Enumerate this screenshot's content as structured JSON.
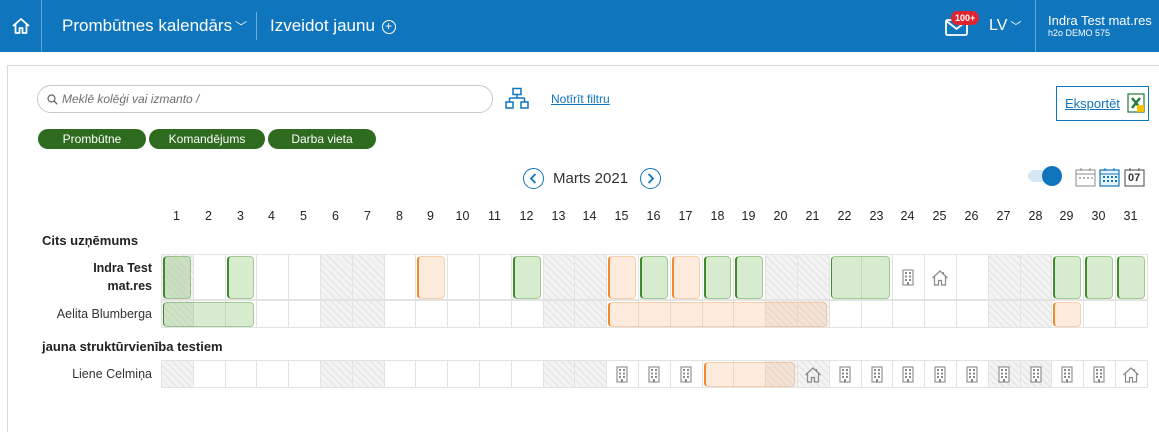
{
  "topbar": {
    "home_icon": "home-icon",
    "title": "Prombūtnes kalendārs",
    "create_label": "Izveidot jaunu",
    "mail_icon": "mail-icon",
    "notification_count": "100+",
    "language": "LV",
    "user_name": "Indra Test mat.res",
    "user_org": "h2o DEMO 575"
  },
  "toolbar": {
    "search_placeholder": "Meklē kolēģi vai izmanto /",
    "search_value": "",
    "clear_filter": "Notīrīt filtru",
    "export_label": "Eksportēt"
  },
  "chips": [
    "Prombūtne",
    "Komandējums",
    "Darba vieta"
  ],
  "calendar": {
    "month_label": "Marts 2021",
    "today_label": "07",
    "days": [
      "1",
      "2",
      "3",
      "4",
      "5",
      "6",
      "7",
      "8",
      "9",
      "10",
      "11",
      "12",
      "13",
      "14",
      "15",
      "16",
      "17",
      "18",
      "19",
      "20",
      "21",
      "22",
      "23",
      "24",
      "25",
      "26",
      "27",
      "28",
      "29",
      "30",
      "31"
    ],
    "weekend_days": [
      6,
      7,
      13,
      14,
      20,
      21,
      27,
      28
    ],
    "sections": [
      {
        "name": "Cits uzņēmums",
        "people": [
          {
            "name_lines": [
              "Indra Test",
              "mat.res"
            ],
            "bold": true,
            "hatched_extra_days": [
              1
            ],
            "marks": [
              {
                "start": 1,
                "end": 1,
                "color": "g",
                "hatch": true
              },
              {
                "start": 3,
                "end": 3,
                "color": "g"
              },
              {
                "start": 9,
                "end": 9,
                "color": "o"
              },
              {
                "start": 12,
                "end": 12,
                "color": "g"
              },
              {
                "start": 15,
                "end": 15,
                "color": "o"
              },
              {
                "start": 16,
                "end": 16,
                "color": "g"
              },
              {
                "start": 17,
                "end": 17,
                "color": "o"
              },
              {
                "start": 18,
                "end": 18,
                "color": "g"
              },
              {
                "start": 19,
                "end": 19,
                "color": "g"
              },
              {
                "start": 22,
                "end": 23,
                "color": "g",
                "thin": true
              },
              {
                "start": 29,
                "end": 29,
                "color": "g"
              },
              {
                "start": 30,
                "end": 30,
                "color": "g"
              },
              {
                "start": 31,
                "end": 31,
                "color": "g"
              }
            ],
            "icons": [
              {
                "day": 24,
                "type": "office"
              },
              {
                "day": 25,
                "type": "home"
              }
            ]
          },
          {
            "name_lines": [
              "Aelita Blumberga"
            ],
            "bold": false,
            "hatched_extra_days": [
              1
            ],
            "marks": [
              {
                "start": 1,
                "end": 3,
                "color": "g",
                "thin": true
              },
              {
                "start": 15,
                "end": 21,
                "color": "o"
              },
              {
                "start": 29,
                "end": 29,
                "color": "o"
              }
            ],
            "icons": []
          }
        ]
      },
      {
        "name": "jauna struktūrvienība testiem",
        "people": [
          {
            "name_lines": [
              "Liene Celmiņa"
            ],
            "bold": false,
            "hatched_extra_days": [
              1
            ],
            "marks": [
              {
                "start": 18,
                "end": 20,
                "color": "o"
              }
            ],
            "icons": [
              {
                "day": 15,
                "type": "office"
              },
              {
                "day": 16,
                "type": "office"
              },
              {
                "day": 17,
                "type": "office"
              },
              {
                "day": 21,
                "type": "home"
              },
              {
                "day": 22,
                "type": "office"
              },
              {
                "day": 23,
                "type": "office"
              },
              {
                "day": 24,
                "type": "office"
              },
              {
                "day": 25,
                "type": "office"
              },
              {
                "day": 26,
                "type": "office"
              },
              {
                "day": 27,
                "type": "office"
              },
              {
                "day": 28,
                "type": "office"
              },
              {
                "day": 29,
                "type": "office"
              },
              {
                "day": 30,
                "type": "office"
              },
              {
                "day": 31,
                "type": "home"
              }
            ]
          }
        ]
      }
    ]
  },
  "colors": {
    "brand_blue": "#0f75bd",
    "chip_green": "#2f6b1f",
    "absence_green": "#7bbe60",
    "trip_orange": "#f08a2e",
    "badge_red": "#e0242f"
  }
}
